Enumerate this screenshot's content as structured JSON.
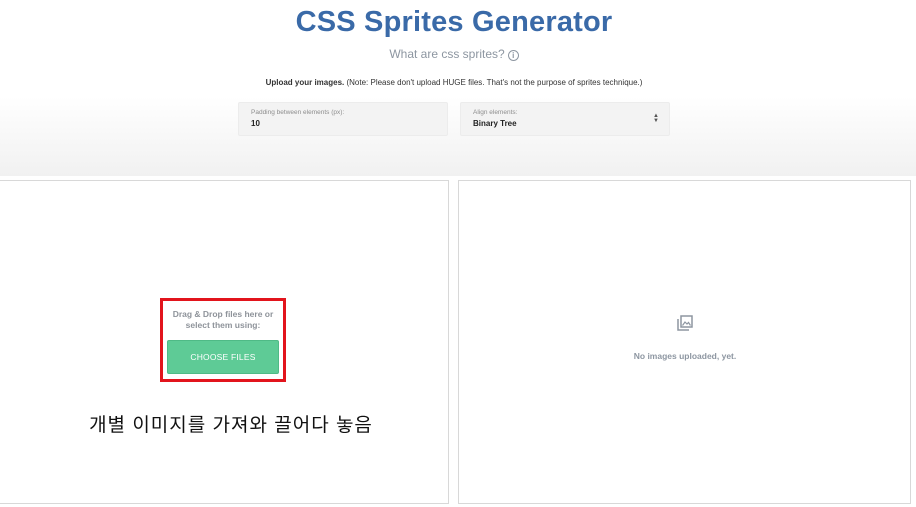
{
  "header": {
    "title": "CSS Sprites Generator",
    "subtitle": "What are css sprites?",
    "upload_note_bold": "Upload your images.",
    "upload_note_rest": " (Note: Please don't upload HUGE files. That's not the purpose of sprites technique.)"
  },
  "settings": {
    "padding": {
      "label": "Padding between elements (px):",
      "value": "10"
    },
    "align": {
      "label": "Align elements:",
      "value": "Binary Tree"
    }
  },
  "dropzone": {
    "text": "Drag & Drop files here or select them using:",
    "button_label": "CHOOSE FILES",
    "highlight_color": "#e2141c",
    "button_color": "#5ecb96"
  },
  "annotation": "개별 이미지를 가져와 끌어다 놓음",
  "preview": {
    "icon": "image-gallery-icon",
    "empty_text": "No images uploaded, yet."
  },
  "colors": {
    "title": "#3a6aa8",
    "muted_text": "#8d96a1"
  }
}
